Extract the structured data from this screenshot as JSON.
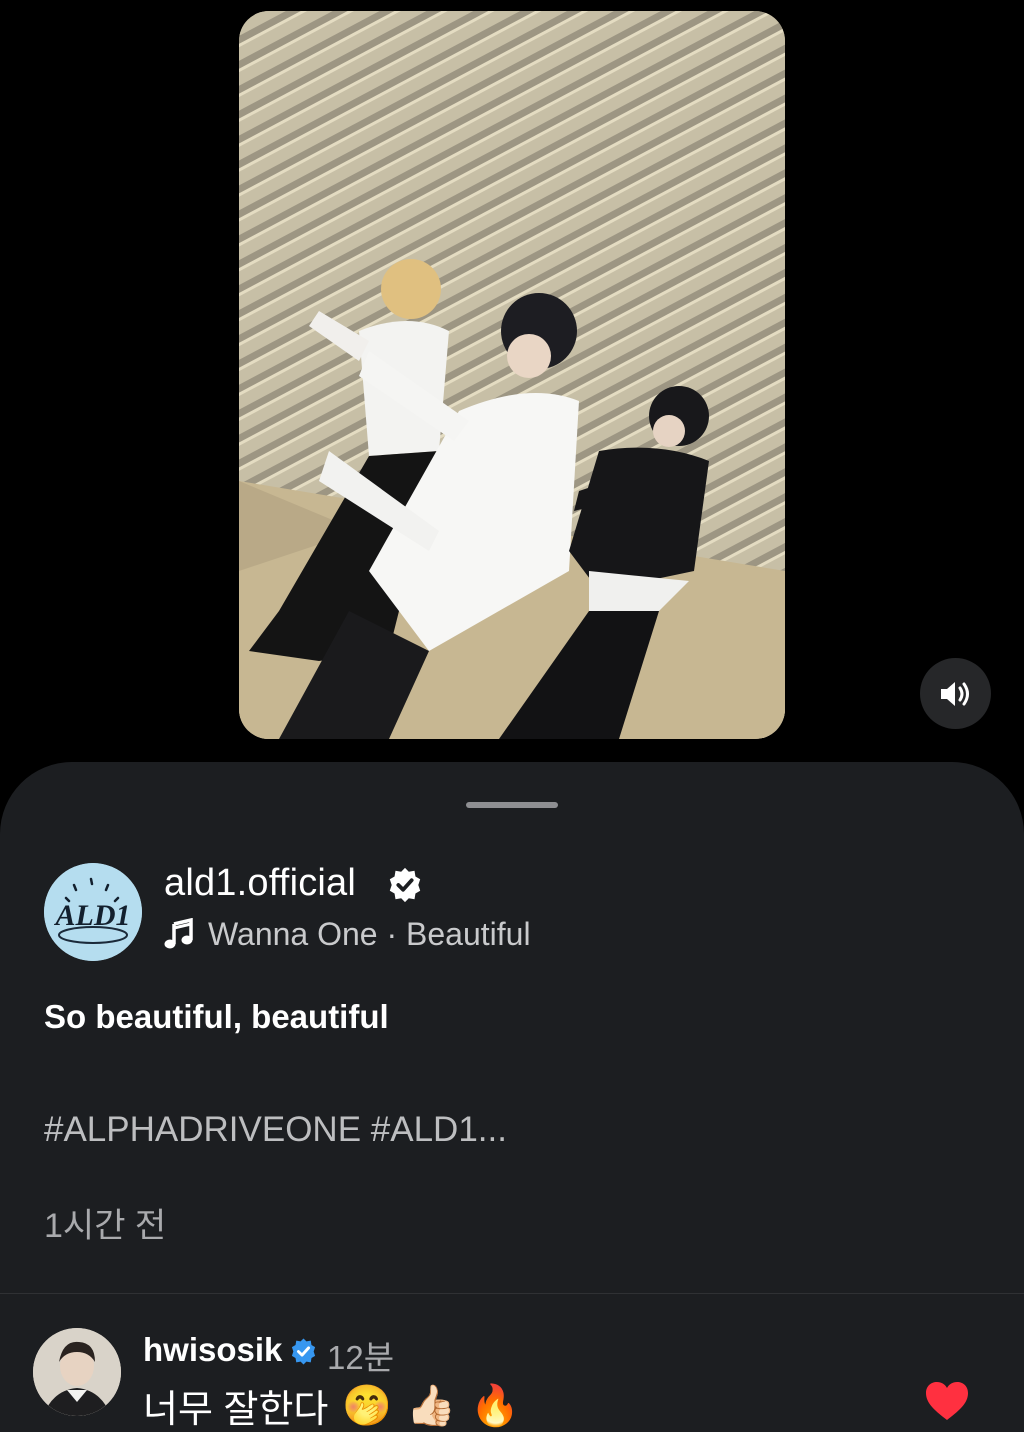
{
  "post": {
    "username": "ald1.official",
    "music": "Wanna One · Beautiful",
    "caption": "So beautiful, beautiful",
    "hashtags": "#ALPHADRIVEONE #ALD1...",
    "time_ago": "1시간 전",
    "avatar_logo_text": "ALD1"
  },
  "comment": {
    "username": "hwisosik",
    "time": "12분",
    "text": "너무 잘한다",
    "emojis": [
      "🤭",
      "👍🏻",
      "🔥"
    ]
  },
  "colors": {
    "sheet_background": "#1c1e21",
    "page_background": "#000000",
    "like_heart": "#ff3040",
    "avatar_bg": "#b5ddef"
  },
  "icons": {
    "sound": "speaker-icon",
    "verified": "verified-badge-icon",
    "music": "music-note-icon",
    "like": "heart-icon"
  }
}
